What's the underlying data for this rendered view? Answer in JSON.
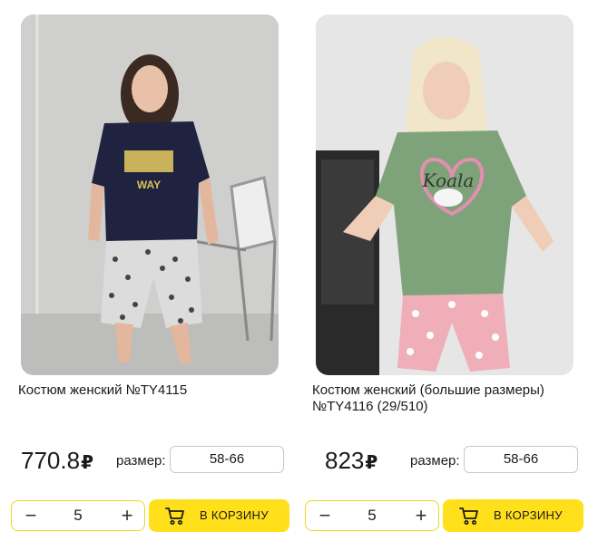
{
  "products": [
    {
      "title": "Костюм женский №TY4115",
      "price": "770.8",
      "currency": "₽",
      "size_label": "размер:",
      "size_value": "58-66",
      "quantity": "5",
      "minus": "−",
      "plus": "+",
      "cart_label": "В КОРЗИНУ",
      "photo_text": "WAY"
    },
    {
      "title": "Костюм женский (большие размеры) №TY4116 (29/510)",
      "price": "823",
      "currency": "₽",
      "size_label": "размер:",
      "size_value": "58-66",
      "quantity": "5",
      "minus": "−",
      "plus": "+",
      "cart_label": "В КОРЗИНУ",
      "photo_text": "Koala"
    }
  ],
  "colors": {
    "accent": "#ffe01a",
    "border_qty": "#f2d320"
  }
}
